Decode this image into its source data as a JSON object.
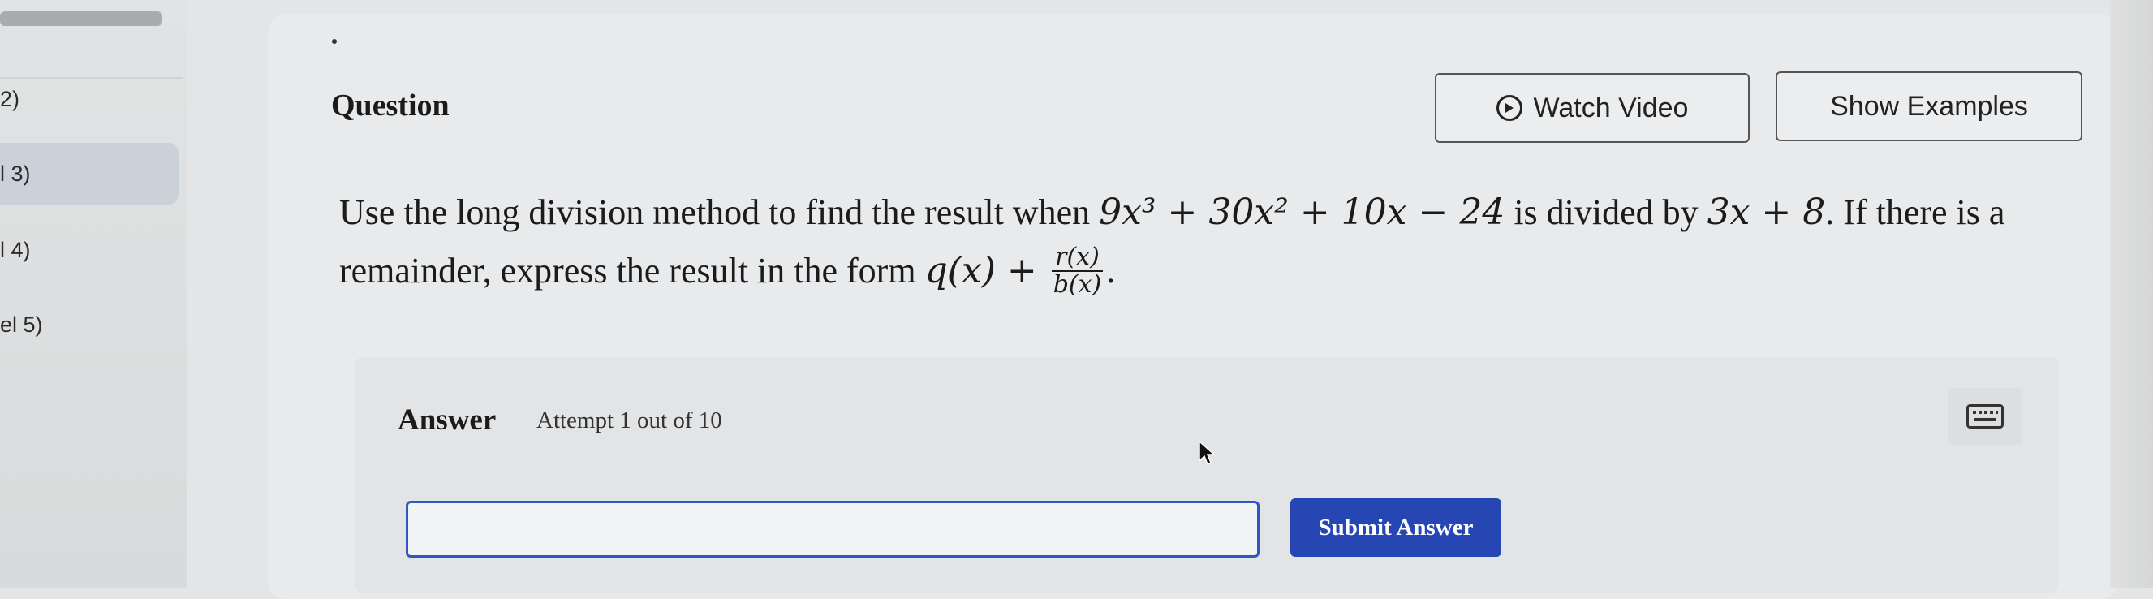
{
  "sidebar": {
    "items": [
      {
        "label": "2)"
      },
      {
        "label": "l 3)"
      },
      {
        "label": "l 4)"
      },
      {
        "label": "el 5)"
      }
    ]
  },
  "question": {
    "title": "Question",
    "watch_video_label": "Watch Video",
    "show_examples_label": "Show Examples",
    "text_part1": "Use the long division method to find the result when ",
    "poly_dividend": "9x³ + 30x² + 10x − 24",
    "text_part2": " is divided by ",
    "poly_divisor": "3x + 8",
    "text_part3": ". If there is a remainder, express the result in the form ",
    "form_q": "q(x) + ",
    "form_num": "r(x)",
    "form_den": "b(x)",
    "text_part4": "."
  },
  "answer": {
    "label": "Answer",
    "attempt": "Attempt 1 out of 10",
    "input_value": "",
    "input_placeholder": "",
    "submit_label": "Submit Answer"
  },
  "icons": {
    "play": "play-circle-icon",
    "keyboard": "keyboard-icon",
    "cursor": "mouse-pointer-icon"
  },
  "colors": {
    "submit_bg": "#2546b3",
    "input_border": "#2f57c8"
  }
}
